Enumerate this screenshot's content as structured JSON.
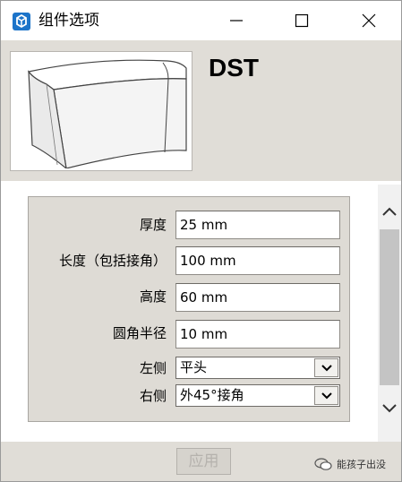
{
  "window": {
    "title": "组件选项",
    "icon": "sketchup-logo-icon"
  },
  "component": {
    "name": "DST"
  },
  "form": {
    "fields": [
      {
        "label": "厚度",
        "value": "25 mm"
      },
      {
        "label": "长度（包括接角）",
        "value": "100 mm"
      },
      {
        "label": "高度",
        "value": "60 mm"
      },
      {
        "label": "圆角半径",
        "value": "10 mm"
      }
    ],
    "selects": [
      {
        "label": "左侧",
        "value": "平头"
      },
      {
        "label": "右侧",
        "value": "外45°接角"
      }
    ]
  },
  "footer": {
    "apply_label": "应用",
    "watermark": "能孩子出没"
  },
  "colors": {
    "panel": "#dedbd5",
    "header": "#e0ddd7",
    "accent": "#1c74c9"
  }
}
